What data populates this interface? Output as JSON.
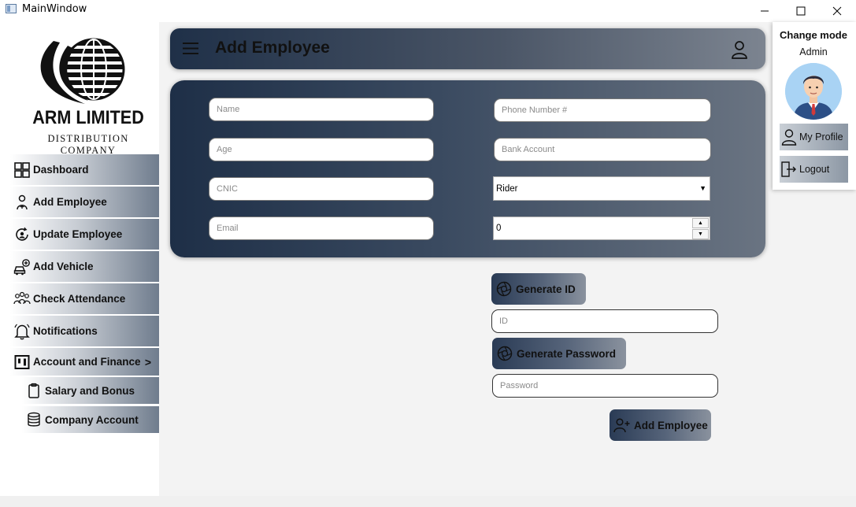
{
  "window": {
    "title": "MainWindow"
  },
  "logo": {
    "name": "ARM LIMITED",
    "tagline": "DISTRIBUTION COMPANY"
  },
  "sidebar": {
    "items": [
      {
        "label": "Dashboard",
        "icon": "dashboard-icon"
      },
      {
        "label": "Add Employee",
        "icon": "add-employee-icon"
      },
      {
        "label": "Update Employee",
        "icon": "update-employee-icon"
      },
      {
        "label": "Add Vehicle",
        "icon": "add-vehicle-icon"
      },
      {
        "label": "Check Attendance",
        "icon": "attendance-icon"
      },
      {
        "label": "Notifications",
        "icon": "bell-icon"
      },
      {
        "label": "Account and Finance",
        "icon": "finance-icon",
        "chevron": ">"
      }
    ],
    "subitems": [
      {
        "label": "Salary and Bonus",
        "icon": "clipboard-icon"
      },
      {
        "label": "Company Account",
        "icon": "database-icon"
      }
    ]
  },
  "header": {
    "title": "Add Employee"
  },
  "form": {
    "name_placeholder": "Name",
    "age_placeholder": "Age",
    "cnic_placeholder": "CNIC",
    "email_placeholder": "Email",
    "phone_placeholder": "Phone Number #",
    "bank_placeholder": "Bank Account",
    "role_selected": "Rider",
    "spin_value": "0"
  },
  "actions": {
    "generate_id_label": "Generate ID",
    "id_placeholder": "ID",
    "generate_password_label": "Generate Password",
    "password_placeholder": "Password",
    "add_employee_label": "Add Employee"
  },
  "profile": {
    "change_mode": "Change mode",
    "role": "Admin",
    "my_profile_label": "My Profile",
    "logout_label": "Logout"
  },
  "colors": {
    "accent_dark": "#1f3048",
    "accent_light": "#7c8490"
  }
}
